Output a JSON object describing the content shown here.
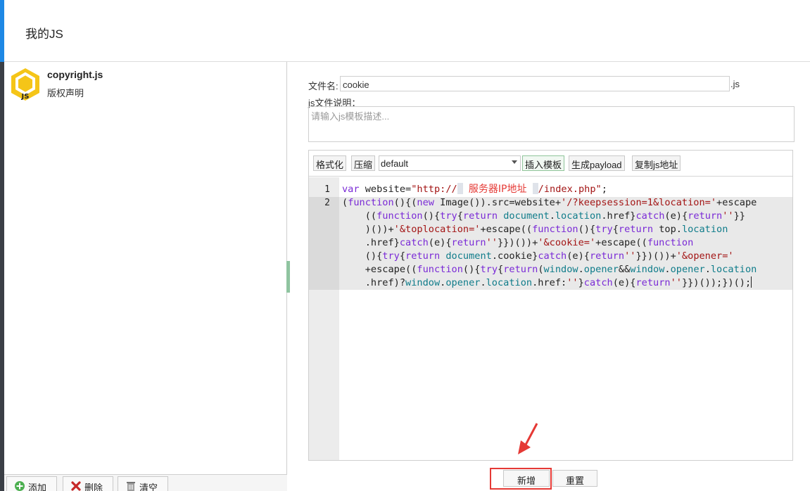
{
  "header": {
    "title": "我的JS"
  },
  "left": {
    "items": [
      {
        "name": "copyright.js",
        "desc": "版权声明",
        "icon": "js-hexagon-icon",
        "icon_text": "JS"
      }
    ],
    "buttons": {
      "add": "添加",
      "delete": "删除",
      "clear": "清空"
    }
  },
  "form": {
    "filename_label": "文件名:",
    "filename_value": "cookie",
    "filename_suffix": ".js",
    "desc_label": "js文件说明：",
    "desc_placeholder": "请输入js模板描述..."
  },
  "toolbar": {
    "format": "格式化",
    "compress": "压缩",
    "template_select": "default",
    "insert_template": "插入模板",
    "gen_payload": "生成payload",
    "copy_url": "复制js地址"
  },
  "code": {
    "line_numbers": [
      "1",
      "2"
    ],
    "annotation": "服务器IP地址"
  },
  "actions": {
    "add": "新增",
    "reset": "重置"
  },
  "colors": {
    "accent": "#1e88e5",
    "highlight": "#e53935",
    "keyword": "#7a2ad6",
    "string": "#a31515",
    "property": "#0f7c8a"
  }
}
